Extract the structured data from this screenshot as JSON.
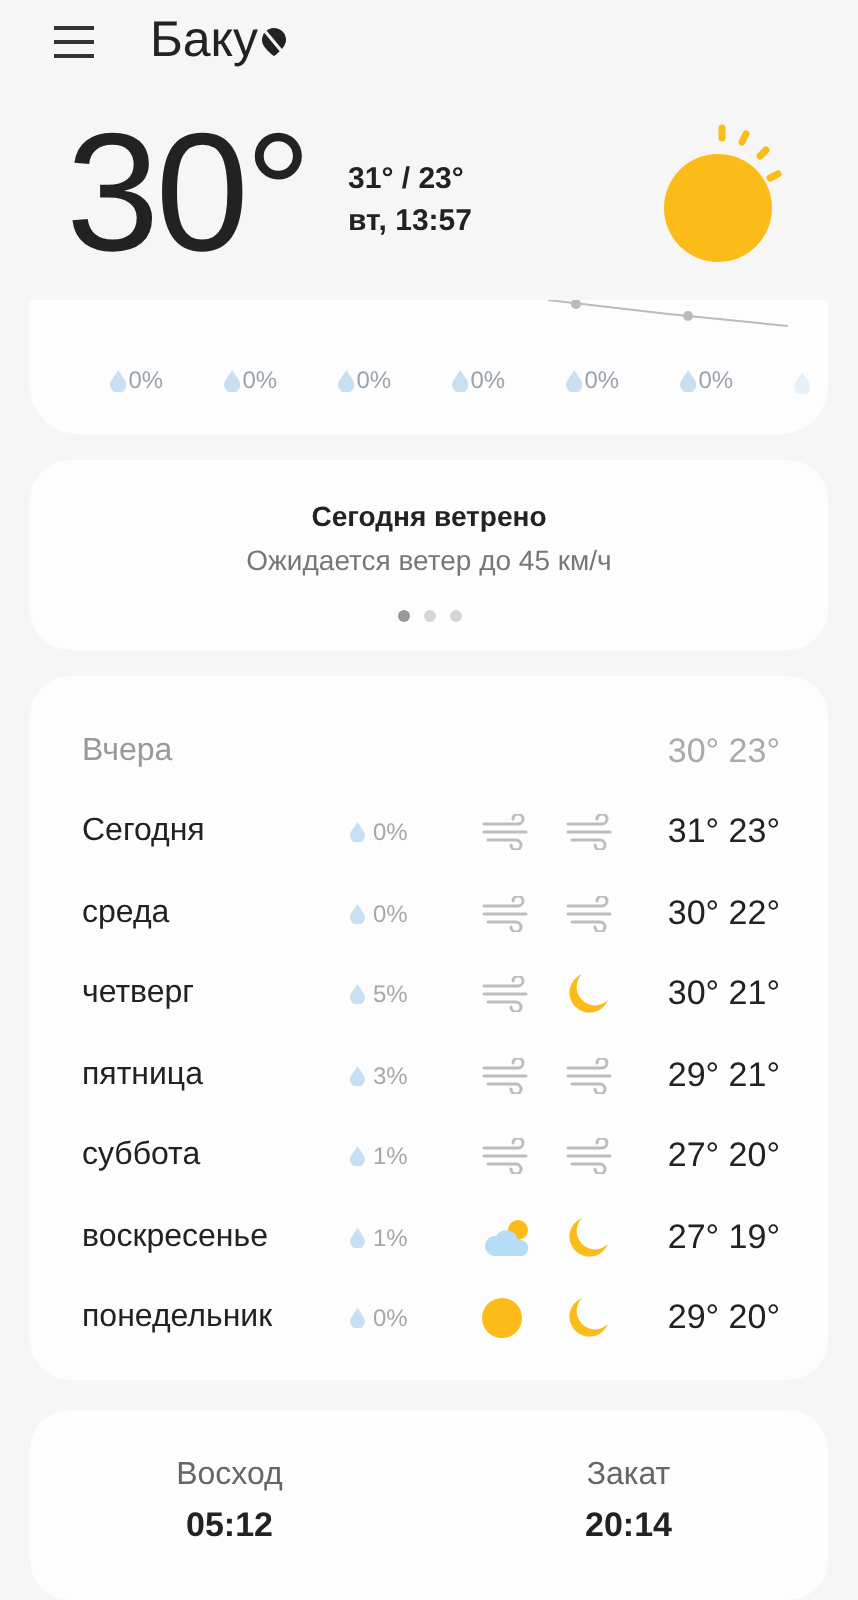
{
  "header": {
    "city": "Баку"
  },
  "current": {
    "temperature": "30°",
    "high_low": "31° / 23°",
    "datetime": "вт, 13:57",
    "icon": {
      "kind": "sun"
    }
  },
  "hourly": {
    "precipitation": [
      "0%",
      "0%",
      "0%",
      "0%",
      "0%",
      "0%"
    ]
  },
  "notice": {
    "title": "Сегодня ветрено",
    "text": "Ожидается ветер до 45 км/ч",
    "pages": [
      {
        "selected": true
      },
      {
        "selected": false
      },
      {
        "selected": false
      }
    ]
  },
  "daily": {
    "yesterday": {
      "label": "Вчера",
      "temps": "30° 23°"
    },
    "days": [
      {
        "day": "Сегодня",
        "precip": "0%",
        "icons": [
          {
            "kind": "wind"
          },
          {
            "kind": "wind"
          }
        ],
        "temps": "31° 23°"
      },
      {
        "day": "среда",
        "precip": "0%",
        "icons": [
          {
            "kind": "wind"
          },
          {
            "kind": "wind"
          }
        ],
        "temps": "30° 22°"
      },
      {
        "day": "четверг",
        "precip": "5%",
        "icons": [
          {
            "kind": "wind"
          },
          {
            "kind": "moon"
          }
        ],
        "temps": "30° 21°"
      },
      {
        "day": "пятница",
        "precip": "3%",
        "icons": [
          {
            "kind": "wind"
          },
          {
            "kind": "wind"
          }
        ],
        "temps": "29° 21°"
      },
      {
        "day": "суббота",
        "precip": "1%",
        "icons": [
          {
            "kind": "wind"
          },
          {
            "kind": "wind"
          }
        ],
        "temps": "27° 20°"
      },
      {
        "day": "воскресенье",
        "precip": "1%",
        "icons": [
          {
            "kind": "partly-cloudy"
          },
          {
            "kind": "moon"
          }
        ],
        "temps": "27° 19°"
      },
      {
        "day": "понедельник",
        "precip": "0%",
        "icons": [
          {
            "kind": "sun"
          },
          {
            "kind": "moon"
          }
        ],
        "temps": "29° 20°"
      }
    ]
  },
  "sun": [
    {
      "label": "Восход",
      "time": "05:12"
    },
    {
      "label": "Закат",
      "time": "20:14"
    }
  ]
}
